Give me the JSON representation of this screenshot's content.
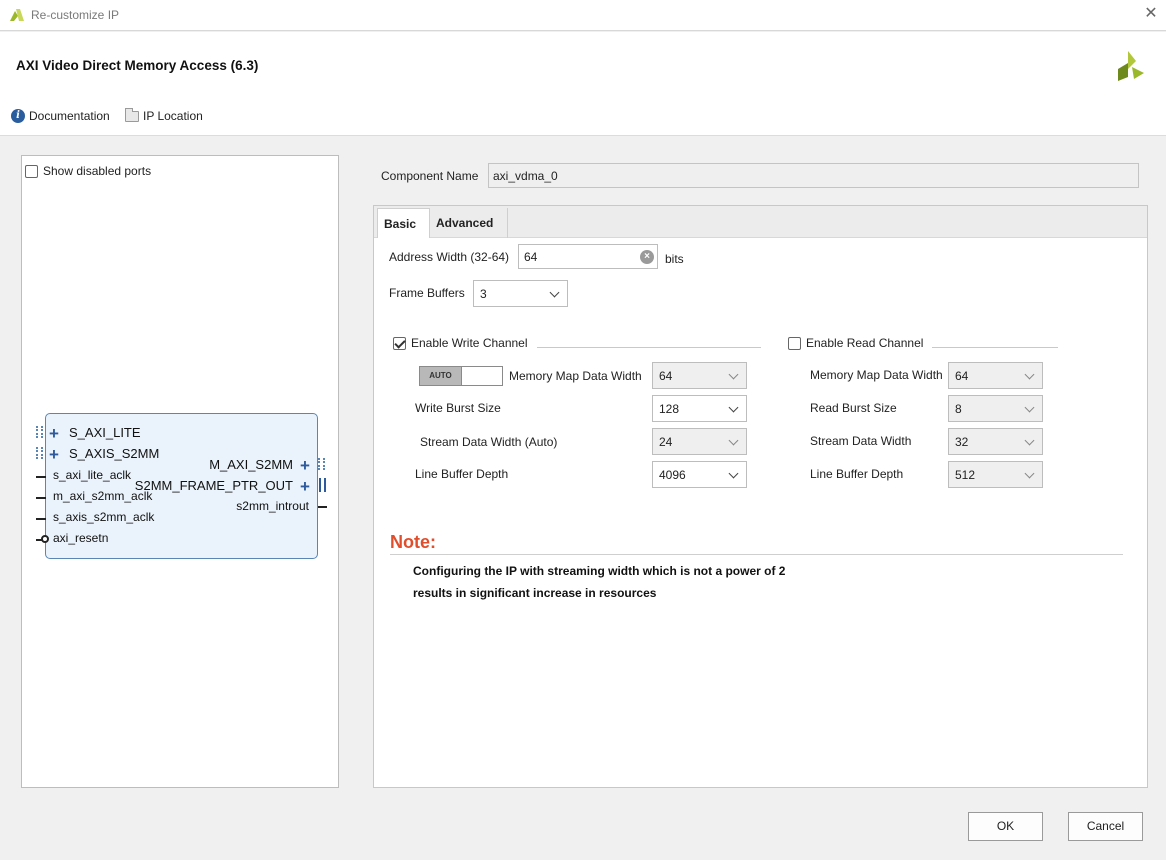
{
  "window": {
    "title": "Re-customize IP"
  },
  "header": {
    "ip_title": "AXI Video Direct Memory Access (6.3)",
    "documentation": "Documentation",
    "ip_location": "IP Location"
  },
  "left": {
    "show_disabled_ports": "Show disabled ports",
    "ports_left": [
      "S_AXI_LITE",
      "S_AXIS_S2MM",
      "s_axi_lite_aclk",
      "m_axi_s2mm_aclk",
      "s_axis_s2mm_aclk",
      "axi_resetn"
    ],
    "ports_right": [
      "M_AXI_S2MM",
      "S2MM_FRAME_PTR_OUT",
      "s2mm_introut"
    ]
  },
  "component": {
    "label": "Component Name",
    "value": "axi_vdma_0"
  },
  "tabs": [
    "Basic",
    "Advanced"
  ],
  "basic": {
    "address_width_label": "Address Width (32-64)",
    "address_width_value": "64",
    "address_width_unit": "bits",
    "frame_buffers_label": "Frame Buffers",
    "frame_buffers_value": "3"
  },
  "write_channel": {
    "title": "Enable Write Channel",
    "enabled": true,
    "auto_label": "AUTO",
    "mm_data_width_label": "Memory Map Data Width",
    "mm_data_width_value": "64",
    "burst_label": "Write Burst Size",
    "burst_value": "128",
    "stream_label": "Stream Data Width (Auto)",
    "stream_value": "24",
    "line_buffer_label": "Line Buffer Depth",
    "line_buffer_value": "4096"
  },
  "read_channel": {
    "title": "Enable Read Channel",
    "enabled": false,
    "mm_data_width_label": "Memory Map Data Width",
    "mm_data_width_value": "64",
    "burst_label": "Read Burst Size",
    "burst_value": "8",
    "stream_label": "Stream Data Width",
    "stream_value": "32",
    "line_buffer_label": "Line Buffer Depth",
    "line_buffer_value": "512"
  },
  "note": {
    "title": "Note:",
    "line1": "Configuring the IP with streaming width which is not a power of 2",
    "line2": "results in significant increase in resources"
  },
  "buttons": {
    "ok": "OK",
    "cancel": "Cancel"
  },
  "colors": {
    "accent_blue": "#2d5a9c",
    "note_red": "#e04e2c",
    "block_fill": "#eaf3fb",
    "logo_green": "#9bb82a"
  }
}
